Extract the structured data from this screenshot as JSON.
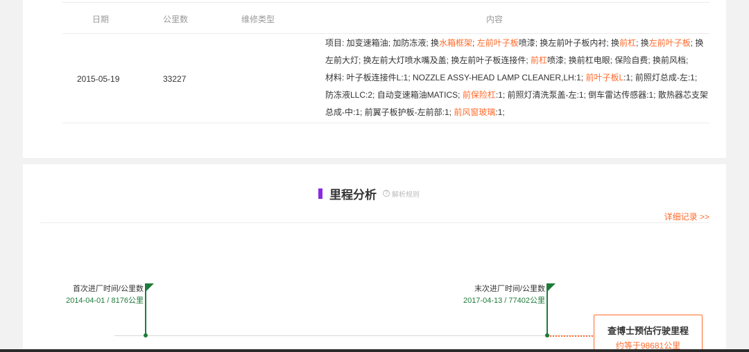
{
  "table": {
    "headers": {
      "date": "日期",
      "mileage": "公里数",
      "type": "维修类型",
      "content": "内容"
    },
    "row": {
      "date": "2015-05-19",
      "mileage": "33227",
      "type": "",
      "lines": [
        [
          {
            "t": "项目: 加变速箱油; 加防冻液; 换"
          },
          {
            "t": "水箱框架",
            "hl": true
          },
          {
            "t": "; "
          },
          {
            "t": "左前叶子板",
            "hl": true
          },
          {
            "t": "喷漆; 换左前叶子板内衬; 换"
          },
          {
            "t": "前杠",
            "hl": true
          },
          {
            "t": "; 换"
          },
          {
            "t": "左前叶子板",
            "hl": true
          },
          {
            "t": "; 换"
          }
        ],
        [
          {
            "t": "左前大灯; 换左前大灯喷水嘴及盖; 换左前叶子板连接件; "
          },
          {
            "t": "前杠",
            "hl": true
          },
          {
            "t": "喷漆; 换前杠电眼; 保险自费; 换前风档;"
          }
        ],
        [
          {
            "t": "材料:  叶子板连接件L:1; NOZZLE ASSY-HEAD LAMP CLEANER,LH:1; "
          },
          {
            "t": "前叶子板L",
            "hl": true
          },
          {
            "t": ":1; 前照灯总成-左:1;"
          }
        ],
        [
          {
            "t": "防冻液LLC:2; 自动变速箱油MATICS; "
          },
          {
            "t": "前保险杠",
            "hl": true
          },
          {
            "t": ":1; 前照灯清洗泵盖-左:1; 倒车雷达传感器:1; 散热器芯支架"
          }
        ],
        [
          {
            "t": "总成-中:1; 前翼子板护板-左前部:1; "
          },
          {
            "t": "前风窗玻璃",
            "hl": true
          },
          {
            "t": ":1;"
          }
        ]
      ]
    }
  },
  "mileage": {
    "title": "里程分析",
    "rule_link": "解析规则",
    "detail_link": "详细记录 >>",
    "first": {
      "label": "首次进厂时间/公里数",
      "value": "2014-04-01 / 8176公里"
    },
    "last": {
      "label": "末次进厂时间/公里数",
      "value": "2017-04-13 / 77402公里"
    },
    "estimate": {
      "title": "查博士预估行驶里程",
      "value": "约等于98681公里"
    }
  },
  "colors": {
    "accent": "#ff6b2c",
    "green": "#1e7b3a",
    "purple": "#8a2be2"
  }
}
